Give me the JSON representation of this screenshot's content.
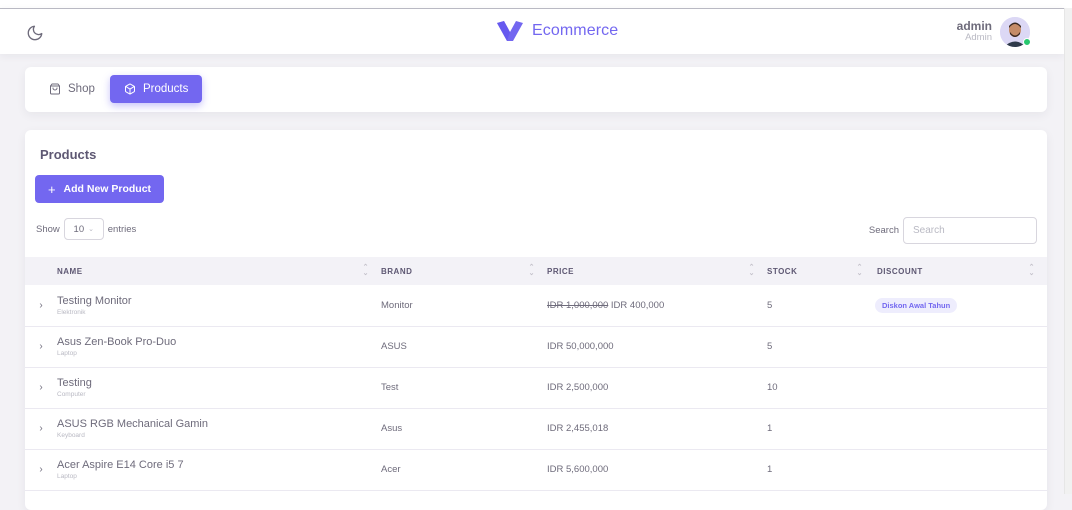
{
  "navbar": {
    "brand_name": "Ecommerce",
    "user_name": "admin",
    "user_role": "Admin",
    "theme_icon": "moon-icon",
    "accent_color": "#7367f0"
  },
  "tabs": [
    {
      "label": "Shop",
      "icon": "shopping-bag-icon",
      "active": false
    },
    {
      "label": "Products",
      "icon": "box-icon",
      "active": true
    }
  ],
  "products_card": {
    "title": "Products",
    "add_button_label": "Add New Product",
    "show_label": "Show",
    "page_length": "10",
    "entries_label": "entries",
    "search_label": "Search",
    "search_placeholder": "Search"
  },
  "table": {
    "columns": [
      "Name",
      "Brand",
      "Price",
      "Stock",
      "Discount"
    ],
    "rows": [
      {
        "name": "Testing Monitor",
        "category": "Elektronik",
        "brand": "Monitor",
        "price_old": "IDR 1,000,000",
        "price": "IDR 400,000",
        "stock": "5",
        "discount": "Diskon Awal Tahun"
      },
      {
        "name": "Asus Zen-Book Pro-Duo",
        "category": "Laptop",
        "brand": "ASUS",
        "price_old": "",
        "price": "IDR 50,000,000",
        "stock": "5",
        "discount": ""
      },
      {
        "name": "Testing",
        "category": "Computer",
        "brand": "Test",
        "price_old": "",
        "price": "IDR 2,500,000",
        "stock": "10",
        "discount": ""
      },
      {
        "name": "ASUS RGB Mechanical Gamin",
        "category": "Keyboard",
        "brand": "Asus",
        "price_old": "",
        "price": "IDR 2,455,018",
        "stock": "1",
        "discount": ""
      },
      {
        "name": "Acer Aspire E14 Core i5 7",
        "category": "Laptop",
        "brand": "Acer",
        "price_old": "",
        "price": "IDR 5,600,000",
        "stock": "1",
        "discount": ""
      }
    ]
  }
}
